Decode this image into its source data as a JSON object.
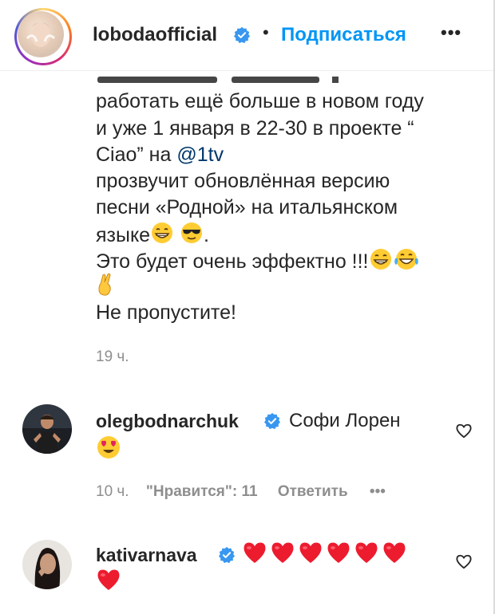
{
  "header": {
    "username": "lobodaofficial",
    "separator": "•",
    "follow_label": "Подписаться",
    "more_label": "•••"
  },
  "caption": {
    "lines": [
      "работать ещё больше в новом году",
      "и уже 1 января в 22-30 в проекте “",
      "Ciao” на ",
      "прозвучит обновлённая версию",
      "песни «Родной» на итальянском",
      "языке",
      "Это будет очень эффектно !!!",
      "Не пропустите!"
    ],
    "mention": "@1tv",
    "period": ".",
    "time": "19 ч."
  },
  "comments": [
    {
      "username": "olegbodnarchuk",
      "text": "Софи Лорен",
      "time": "10 ч.",
      "likes_label": "\"Нравится\": 11",
      "reply_label": "Ответить",
      "more_label": "•••"
    },
    {
      "username": "kativarnava",
      "hearts_count": 7
    }
  ],
  "colors": {
    "link_blue": "#0095f6",
    "mention": "#00376b",
    "verified": "#3897f0",
    "muted": "#8e8e8e",
    "heart": "#ed1b2e"
  },
  "icons": [
    "verified-badge-icon",
    "heart-outline-icon",
    "more-dots-icon",
    "grinning-emoji",
    "sunglasses-emoji",
    "crossed-fingers-emoji",
    "tears-of-joy-emoji",
    "heart-eyes-emoji",
    "red-heart-emoji"
  ]
}
